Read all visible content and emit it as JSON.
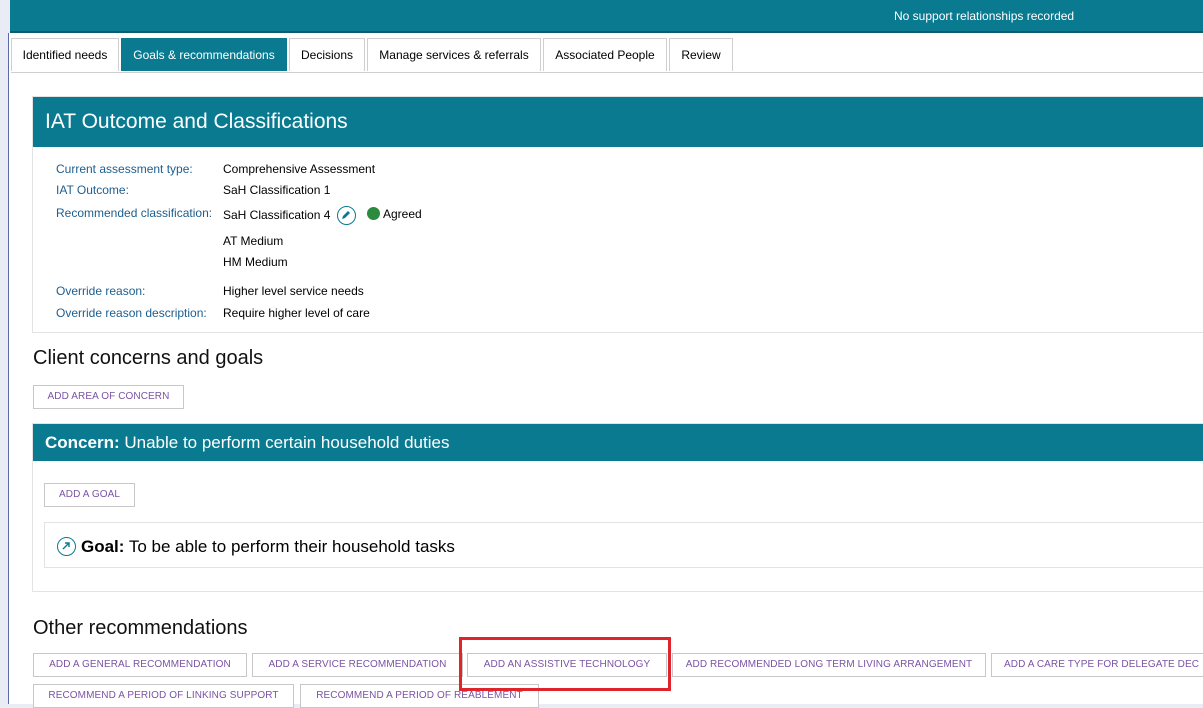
{
  "header": {
    "notice": "No support relationships recorded",
    "accent_color": "#0a7a91"
  },
  "tabs": [
    {
      "label": "Identified needs",
      "active": false
    },
    {
      "label": "Goals & recommendations",
      "active": true
    },
    {
      "label": "Decisions",
      "active": false
    },
    {
      "label": "Manage services & referrals",
      "active": false
    },
    {
      "label": "Associated People",
      "active": false
    },
    {
      "label": "Review",
      "active": false
    }
  ],
  "iat": {
    "title": "IAT Outcome and Classifications",
    "fields": {
      "assessment_type_label": "Current assessment type:",
      "assessment_type_value": "Comprehensive Assessment",
      "outcome_label": "IAT Outcome:",
      "outcome_value": "SaH Classification 1",
      "recommended_label": "Recommended classification:",
      "recommended_value": "SaH Classification 4",
      "status": "Agreed",
      "status_color": "#2b8a3e",
      "at_level": "AT Medium",
      "hm_level": "HM Medium",
      "override_reason_label": "Override reason:",
      "override_reason_value": "Higher level service needs",
      "override_desc_label": "Override reason description:",
      "override_desc_value": "Require higher level of care"
    }
  },
  "concerns": {
    "heading": "Client concerns and goals",
    "add_area_label": "ADD AREA OF CONCERN",
    "concern_prefix": "Concern:",
    "concern_text": "Unable to perform certain household duties",
    "add_goal_label": "ADD A GOAL",
    "goal_prefix": "Goal:",
    "goal_text": "To be able to perform their household tasks"
  },
  "other": {
    "heading": "Other recommendations",
    "buttons_row1": [
      "ADD A GENERAL RECOMMENDATION",
      "ADD A SERVICE RECOMMENDATION",
      "ADD AN ASSISTIVE TECHNOLOGY",
      "ADD RECOMMENDED LONG TERM LIVING ARRANGEMENT",
      "ADD A CARE TYPE FOR DELEGATE DEC"
    ],
    "buttons_row2": [
      "RECOMMEND A PERIOD OF LINKING SUPPORT",
      "RECOMMEND A PERIOD OF REABLEMENT"
    ],
    "highlight_color": "#e0242b"
  }
}
